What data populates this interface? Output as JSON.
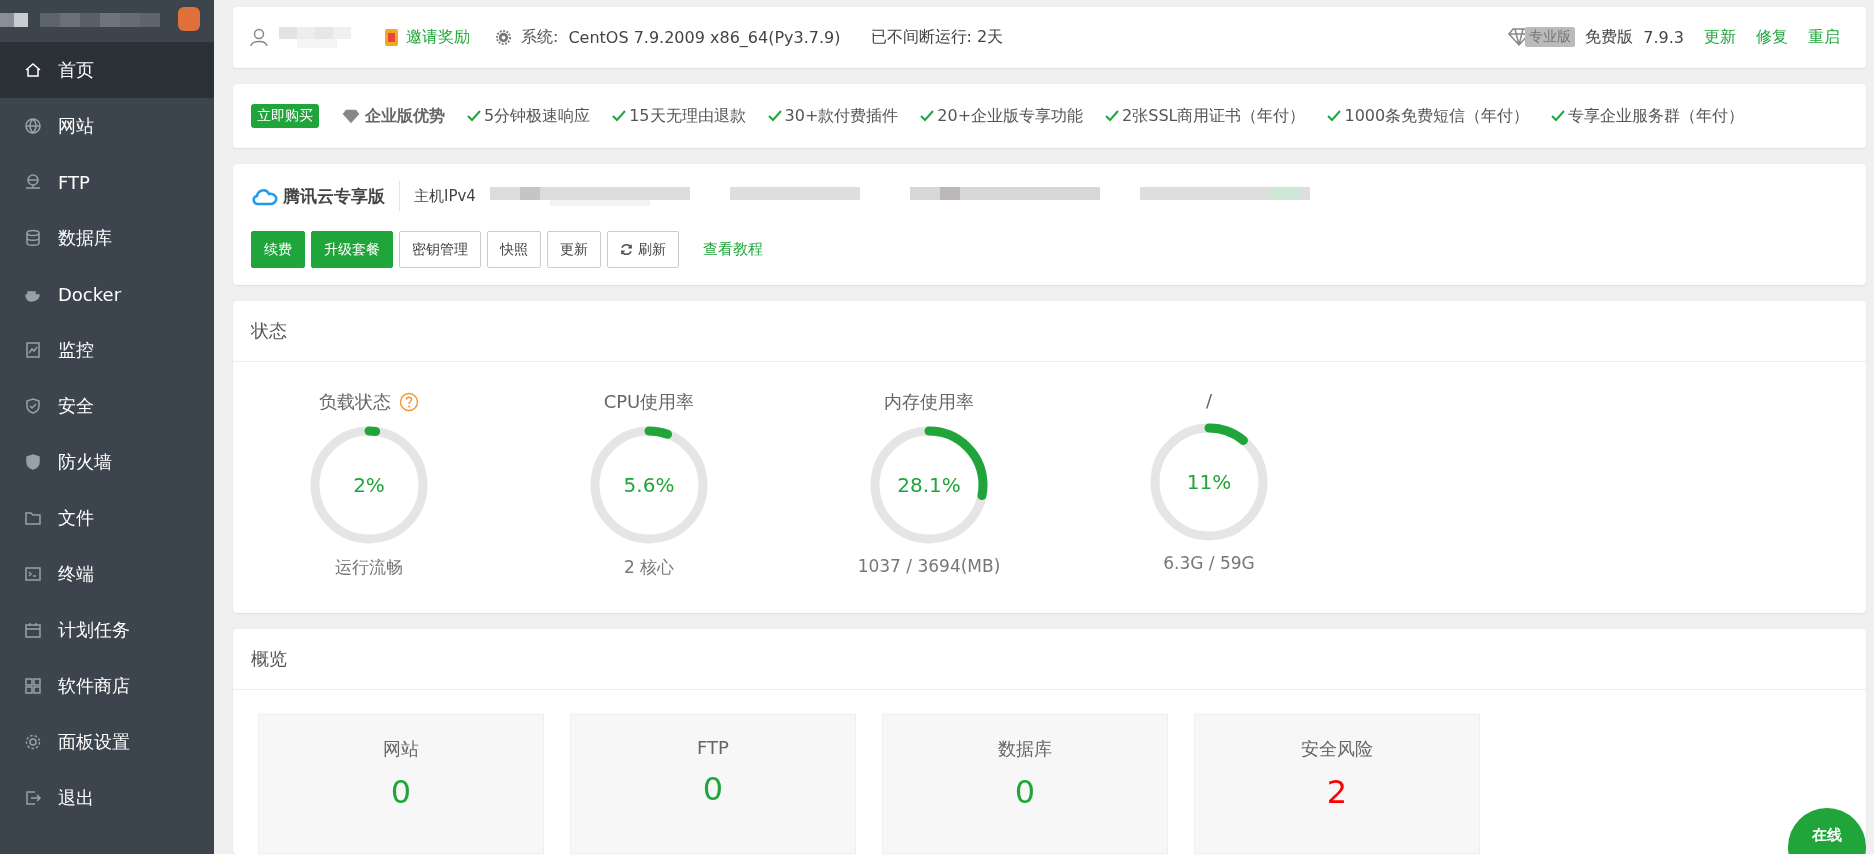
{
  "sidebar": {
    "items": [
      {
        "label": "首页",
        "selected": true
      },
      {
        "label": "网站",
        "selected": false
      },
      {
        "label": "FTP",
        "selected": false
      },
      {
        "label": "数据库",
        "selected": false
      },
      {
        "label": "Docker",
        "selected": false
      },
      {
        "label": "监控",
        "selected": false
      },
      {
        "label": "安全",
        "selected": false
      },
      {
        "label": "防火墙",
        "selected": false
      },
      {
        "label": "文件",
        "selected": false
      },
      {
        "label": "终端",
        "selected": false
      },
      {
        "label": "计划任务",
        "selected": false
      },
      {
        "label": "软件商店",
        "selected": false
      },
      {
        "label": "面板设置",
        "selected": false
      },
      {
        "label": "退出",
        "selected": false
      }
    ]
  },
  "header": {
    "invite": "邀请奖励",
    "system_label": "系统:",
    "system": "CentOS 7.9.2009 x86_64(Py3.7.9)",
    "uptime": "已不间断运行: 2天",
    "pro_badge": "专业版",
    "edition": "免费版",
    "version": "7.9.3",
    "links": [
      "更新",
      "修复",
      "重启"
    ]
  },
  "promo": {
    "buy": "立即购买",
    "title": "企业版优势",
    "features": [
      "5分钟极速响应",
      "15天无理由退款",
      "30+款付费插件",
      "20+企业版专享功能",
      "2张SSL商用证书（年付）",
      "1000条免费短信（年付）",
      "专享企业服务群（年付）"
    ]
  },
  "cloud": {
    "title": "腾讯云专享版",
    "ip_label": "主机IPv4",
    "buttons": [
      {
        "label": "续费",
        "kind": "primary"
      },
      {
        "label": "升级套餐",
        "kind": "primary"
      },
      {
        "label": "密钥管理",
        "kind": "plain"
      },
      {
        "label": "快照",
        "kind": "plain"
      },
      {
        "label": "更新",
        "kind": "plain"
      },
      {
        "label": "刷新",
        "kind": "refresh"
      }
    ],
    "tutorial": "查看教程"
  },
  "status": {
    "title": "状态",
    "gauges": [
      {
        "title": "负载状态",
        "help": true,
        "value": "2%",
        "level": 0.02,
        "footer": "运行流畅"
      },
      {
        "title": "CPU使用率",
        "help": false,
        "value": "5.6%",
        "level": 0.056,
        "footer": "2 核心"
      },
      {
        "title": "内存使用率",
        "help": false,
        "value": "28.1%",
        "level": 0.281,
        "footer": "1037 / 3694(MB)"
      },
      {
        "title": "/",
        "help": false,
        "value": "11%",
        "level": 0.11,
        "footer": "6.3G / 59G"
      }
    ]
  },
  "overview": {
    "title": "概览",
    "cards": [
      {
        "label": "网站",
        "value": "0",
        "color": "#20a53a"
      },
      {
        "label": "FTP",
        "value": "0",
        "color": "#20a53a"
      },
      {
        "label": "数据库",
        "value": "0",
        "color": "#20a53a"
      },
      {
        "label": "安全风险",
        "value": "2",
        "color": "#ff0000"
      }
    ]
  },
  "online_button": "在线"
}
